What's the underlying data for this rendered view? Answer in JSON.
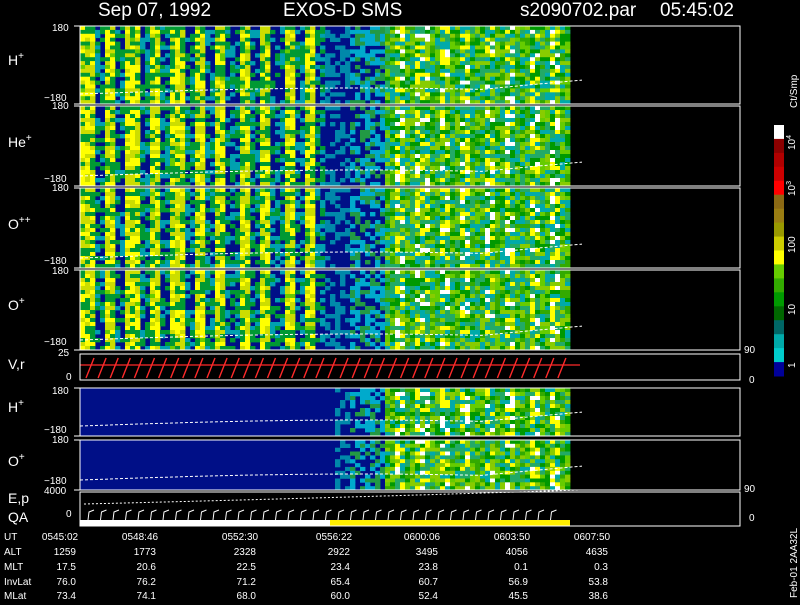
{
  "header": {
    "date": "Sep 07, 1992",
    "instrument": "EXOS-D SMS",
    "file": "s2090702.par",
    "time": "05:45:02"
  },
  "panels": [
    {
      "label": "H",
      "sup": "+",
      "ymax": "180",
      "ymin": "−180"
    },
    {
      "label": "He",
      "sup": "+",
      "ymax": "180",
      "ymin": "−180"
    },
    {
      "label": "O",
      "sup": "++",
      "ymax": "180",
      "ymin": "−180"
    },
    {
      "label": "O",
      "sup": "+",
      "ymax": "180",
      "ymin": "−180"
    }
  ],
  "vr_panel": {
    "label": "V,r",
    "ymax": "25",
    "ymin": "0",
    "right_top": "90",
    "right_bottom": "0"
  },
  "panels2": [
    {
      "label": "H",
      "sup": "+",
      "ymax": "180",
      "ymin": "−180"
    },
    {
      "label": "O",
      "sup": "+",
      "ymax": "180",
      "ymin": "−180"
    }
  ],
  "ep_panel": {
    "label1": "E,p",
    "label2": "QA",
    "ymax": "4000",
    "ymin": "0",
    "right_top": "90",
    "right_bottom": "0"
  },
  "colorbar": {
    "unit": "Ct/Smp",
    "ticks": [
      "10",
      "10",
      "100",
      "10",
      "1"
    ],
    "tick_exps": [
      "4",
      "3",
      "",
      "",
      ""
    ],
    "colors": [
      "#ffffff",
      "#8b0000",
      "#b00000",
      "#cc0000",
      "#ff0000",
      "#8b6914",
      "#9a7d12",
      "#999900",
      "#cccc00",
      "#ffff00",
      "#66cc00",
      "#33aa00",
      "#009900",
      "#006600",
      "#006666",
      "#00aaaa",
      "#00cccc",
      "#000099"
    ]
  },
  "table": {
    "rows": [
      {
        "label": "UT",
        "values": [
          "0545:02",
          "0548:46",
          "0552:30",
          "0556:22",
          "0600:06",
          "0603:50",
          "0607:50"
        ]
      },
      {
        "label": "ALT",
        "values": [
          "1259",
          "1773",
          "2328",
          "2922",
          "3495",
          "4056",
          "4635"
        ]
      },
      {
        "label": "MLT",
        "values": [
          "17.5",
          "20.6",
          "22.5",
          "23.4",
          "23.8",
          "0.1",
          "0.3"
        ]
      },
      {
        "label": "InvLat",
        "values": [
          "76.0",
          "76.2",
          "71.2",
          "65.4",
          "60.7",
          "56.9",
          "53.8"
        ]
      },
      {
        "label": "MLat",
        "values": [
          "73.4",
          "74.1",
          "68.0",
          "60.0",
          "52.4",
          "45.5",
          "38.6"
        ]
      }
    ]
  },
  "footer_id": "Feb-01 2AA32L"
}
